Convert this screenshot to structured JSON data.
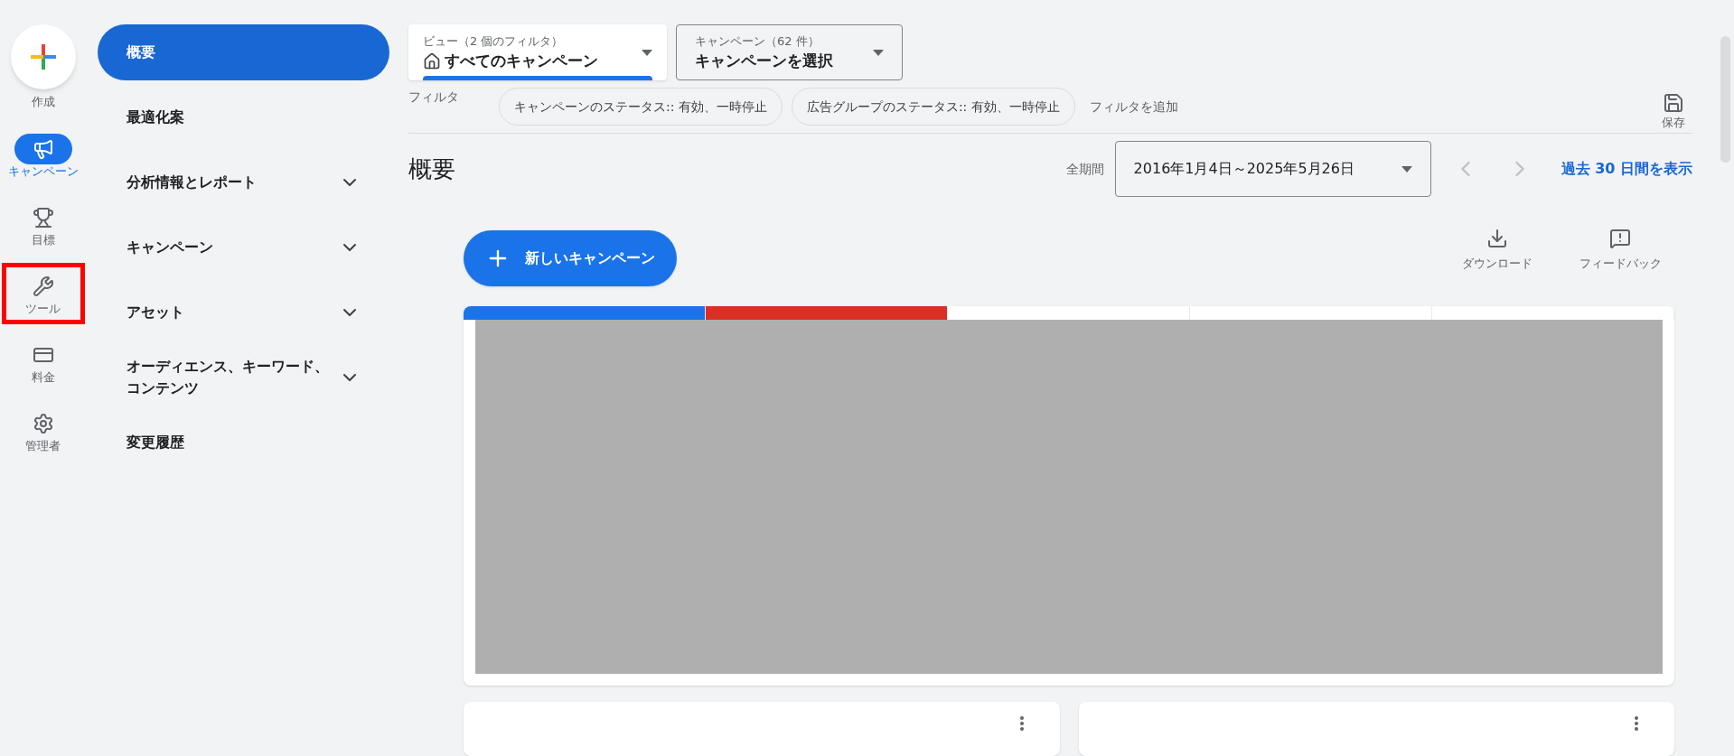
{
  "rail": {
    "create": {
      "label": "作成"
    },
    "items": [
      {
        "kind": "campaign",
        "label": "キャンペーン",
        "selected": true,
        "highlighted": false
      },
      {
        "kind": "goal",
        "label": "目標",
        "selected": false,
        "highlighted": false
      },
      {
        "kind": "tools",
        "label": "ツール",
        "selected": false,
        "highlighted": true
      },
      {
        "kind": "billing",
        "label": "料金",
        "selected": false,
        "highlighted": false
      },
      {
        "kind": "admin",
        "label": "管理者",
        "selected": false,
        "highlighted": false
      }
    ]
  },
  "sidebar": {
    "items": [
      {
        "label": "概要",
        "selected": true,
        "expandable": false
      },
      {
        "label": "最適化案",
        "selected": false,
        "expandable": false
      },
      {
        "label": "分析情報とレポート",
        "selected": false,
        "expandable": true
      },
      {
        "label": "キャンペーン",
        "selected": false,
        "expandable": true
      },
      {
        "label": "アセット",
        "selected": false,
        "expandable": true
      },
      {
        "label": "オーディエンス、キーワード、コンテンツ",
        "selected": false,
        "expandable": true
      },
      {
        "label": "変更履歴",
        "selected": false,
        "expandable": false
      }
    ]
  },
  "view_select": {
    "label": "ビュー（2 個のフィルタ）",
    "value": "すべてのキャンペーン"
  },
  "campaign_select": {
    "label": "キャンペーン（62 件）",
    "value": "キャンペーンを選択"
  },
  "filters": {
    "label": "フィルタ",
    "chips": [
      "キャンペーンのステータス:: 有効、一時停止",
      "広告グループのステータス:: 有効、一時停止"
    ],
    "add": "フィルタを追加"
  },
  "save": {
    "label": "保存"
  },
  "page_title": "概要",
  "date_range": {
    "label": "全期間",
    "value": "2016年1月4日～2025年5月26日",
    "link": "過去 30 日間を表示"
  },
  "new_campaign": "新しいキャンペーン",
  "actions": [
    {
      "kind": "download",
      "label": "ダウンロード"
    },
    {
      "kind": "feedback",
      "label": "フィードバック"
    }
  ],
  "metric_tabs": [
    {
      "color": "#1a73e8",
      "selected": true
    },
    {
      "color": "#d93025",
      "selected": true
    },
    {
      "selected": false
    },
    {
      "selected": false
    },
    {
      "selected": false
    }
  ]
}
